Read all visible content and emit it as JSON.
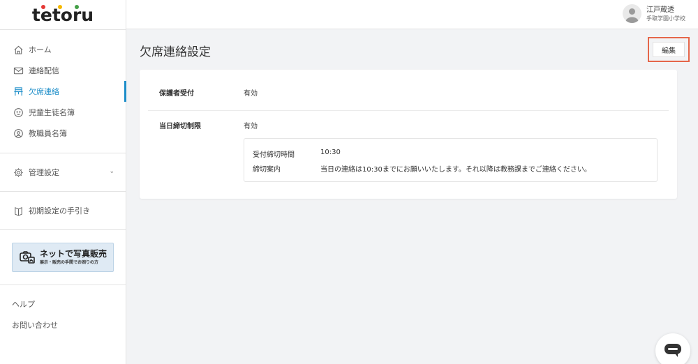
{
  "brand": {
    "logo_text": "tetoru",
    "dot_colors": [
      "#e53935",
      "#f6b800",
      "#43a047"
    ]
  },
  "sidebar": {
    "items": [
      {
        "label": "ホーム",
        "icon": "home-icon"
      },
      {
        "label": "連絡配信",
        "icon": "mail-icon"
      },
      {
        "label": "欠席連絡",
        "icon": "absence-icon",
        "active": true
      },
      {
        "label": "児童生徒名簿",
        "icon": "student-roster-icon"
      },
      {
        "label": "教職員名簿",
        "icon": "staff-roster-icon"
      }
    ],
    "settings": {
      "label": "管理設定"
    },
    "guide": {
      "label": "初期設定の手引き"
    },
    "banner": {
      "title": "ネットで写真販売",
      "subtitle": "展示・販売の手間でお困りの方"
    },
    "help": "ヘルプ",
    "contact": "お問い合わせ",
    "accent_color": "#1e8ec9"
  },
  "header": {
    "user_name": "江戸蔵透",
    "school": "手取学園小学校"
  },
  "page": {
    "title": "欠席連絡設定",
    "edit_label": "編集",
    "guardian_label": "保護者受付",
    "guardian_value": "有効",
    "deadline_label": "当日締切制限",
    "deadline_value": "有効",
    "cutoff_time_label": "受付締切時間",
    "cutoff_time_value": "10:30",
    "cutoff_note_label": "締切案内",
    "cutoff_note_value": "当日の連絡は10:30までにお願いいたします。それ以降は教務課までご連絡ください。"
  }
}
